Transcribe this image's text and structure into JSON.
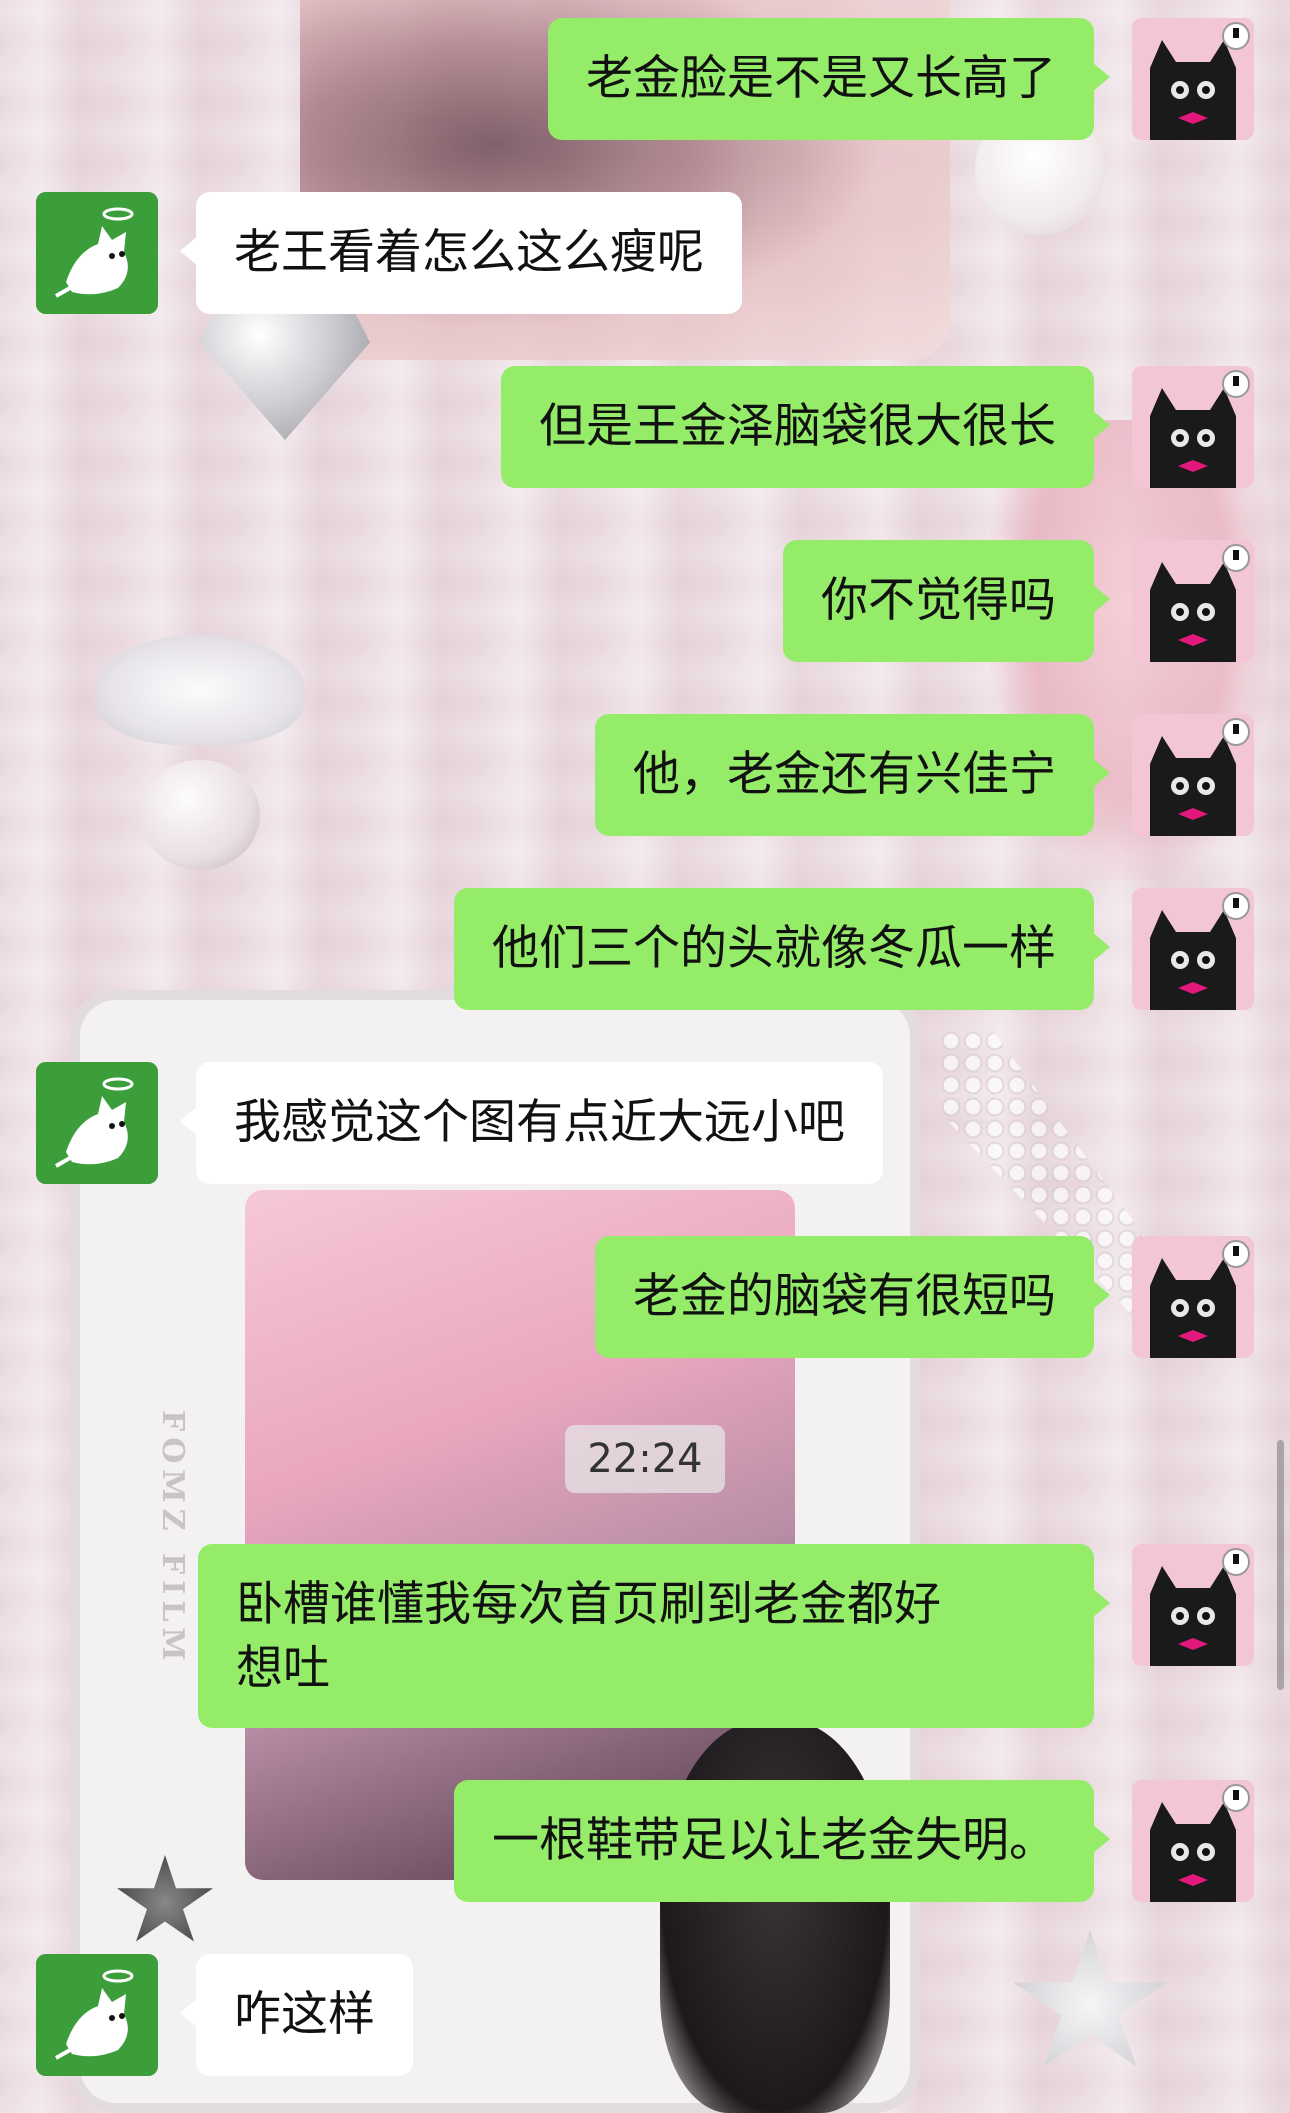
{
  "background": {
    "camera_brand": "FOMZ FILM"
  },
  "messages": [
    {
      "side": "mine",
      "text": "老金脸是不是又长高了"
    },
    {
      "side": "theirs",
      "text": "老王看着怎么这么瘦呢"
    },
    {
      "side": "mine",
      "text": "但是王金泽脑袋很大很长"
    },
    {
      "side": "mine",
      "text": "你不觉得吗"
    },
    {
      "side": "mine",
      "text": "他，老金还有兴佳宁"
    },
    {
      "side": "mine",
      "text": "他们三个的头就像冬瓜一样"
    },
    {
      "side": "theirs",
      "text": "我感觉这个图有点近大远小吧"
    },
    {
      "side": "mine",
      "text": "老金的脑袋有很短吗"
    },
    {
      "side": "mine",
      "text": "卧槽谁懂我每次首页刷到老金都好\n想吐"
    },
    {
      "side": "mine",
      "text": "一根鞋带足以让老金失明。"
    },
    {
      "side": "theirs",
      "text": "咋这样"
    }
  ],
  "timestamp": "22:24",
  "colors": {
    "my_bubble": "#95ec69",
    "their_bubble": "#ffffff",
    "their_avatar_bg": "#3c9e3a",
    "my_avatar_bg": "#f2c6d4"
  },
  "icons": {
    "my_avatar": "black-cat-avatar-icon",
    "their_avatar": "angel-cat-avatar-icon"
  }
}
